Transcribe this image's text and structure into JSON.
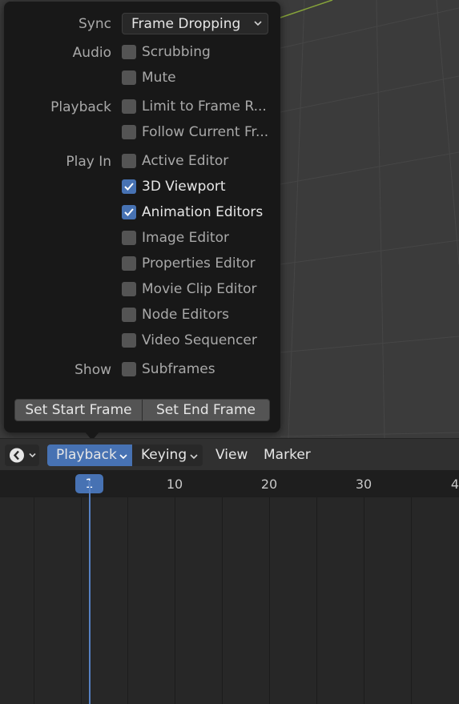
{
  "popup": {
    "sync": {
      "label": "Sync",
      "value": "Frame Dropping"
    },
    "audio": {
      "label": "Audio",
      "options": [
        {
          "label": "Scrubbing",
          "checked": false
        },
        {
          "label": "Mute",
          "checked": false
        }
      ]
    },
    "playback": {
      "label": "Playback",
      "options": [
        {
          "label": "Limit to Frame R...",
          "checked": false
        },
        {
          "label": "Follow Current Fr...",
          "checked": false
        }
      ]
    },
    "play_in": {
      "label": "Play In",
      "options": [
        {
          "label": "Active Editor",
          "checked": false
        },
        {
          "label": "3D Viewport",
          "checked": true
        },
        {
          "label": "Animation Editors",
          "checked": true
        },
        {
          "label": "Image Editor",
          "checked": false
        },
        {
          "label": "Properties Editor",
          "checked": false
        },
        {
          "label": "Movie Clip Editor",
          "checked": false
        },
        {
          "label": "Node Editors",
          "checked": false
        },
        {
          "label": "Video Sequencer",
          "checked": false
        }
      ]
    },
    "show": {
      "label": "Show",
      "options": [
        {
          "label": "Subframes",
          "checked": false
        }
      ]
    },
    "buttons": {
      "start": "Set Start Frame",
      "end": "Set End Frame"
    }
  },
  "header": {
    "editor_type_icon": "clock-icon",
    "menus": {
      "playback": "Playback",
      "keying": "Keying",
      "view": "View",
      "marker": "Marker"
    }
  },
  "timeline": {
    "current_frame": "1",
    "ticks": [
      "10",
      "20",
      "30",
      "4"
    ]
  },
  "colors": {
    "accent": "#4772b3",
    "popup_bg": "#181818",
    "viewport_bg": "#3b3b3b",
    "timeline_bg": "#272727"
  }
}
